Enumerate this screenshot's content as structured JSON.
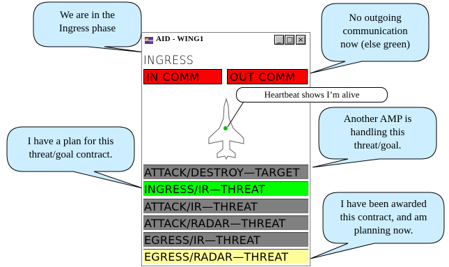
{
  "window": {
    "title": "AID - WING1",
    "minimize_glyph": "_",
    "maximize_glyph": "□",
    "close_glyph": "×",
    "phase": "INGRESS",
    "in_comm_label": "IN COMM",
    "out_comm_label": "OUT COMM",
    "contracts": [
      {
        "label": "ATTACK/DESTROY—TARGET",
        "color": "#808080"
      },
      {
        "label": "INGRESS/IR—THREAT",
        "color": "#00ff00"
      },
      {
        "label": "ATTACK/IR—THREAT",
        "color": "#808080"
      },
      {
        "label": "ATTACK/RADAR—THREAT",
        "color": "#808080"
      },
      {
        "label": "EGRESS/IR—THREAT",
        "color": "#808080"
      },
      {
        "label": "EGRESS/RADAR—THREAT",
        "color": "#ffff99"
      }
    ]
  },
  "callouts": {
    "ingress_phase": [
      "We are in the",
      "Ingress phase"
    ],
    "no_outgoing": [
      "No outgoing",
      "communication",
      "now (else green)"
    ],
    "heartbeat": "Heartbeat shows I’m alive",
    "plan": [
      "I have a plan for this",
      "threat/goal contract."
    ],
    "another_amp": [
      "Another AMP is",
      "handling this",
      "threat/goal."
    ],
    "awarded": [
      "I have been awarded",
      "this contract, and am",
      "planning now."
    ]
  },
  "colors": {
    "callout_fill": "#cceeff",
    "comm_red": "#ff0000",
    "heartbeat_green": "#00c000"
  }
}
